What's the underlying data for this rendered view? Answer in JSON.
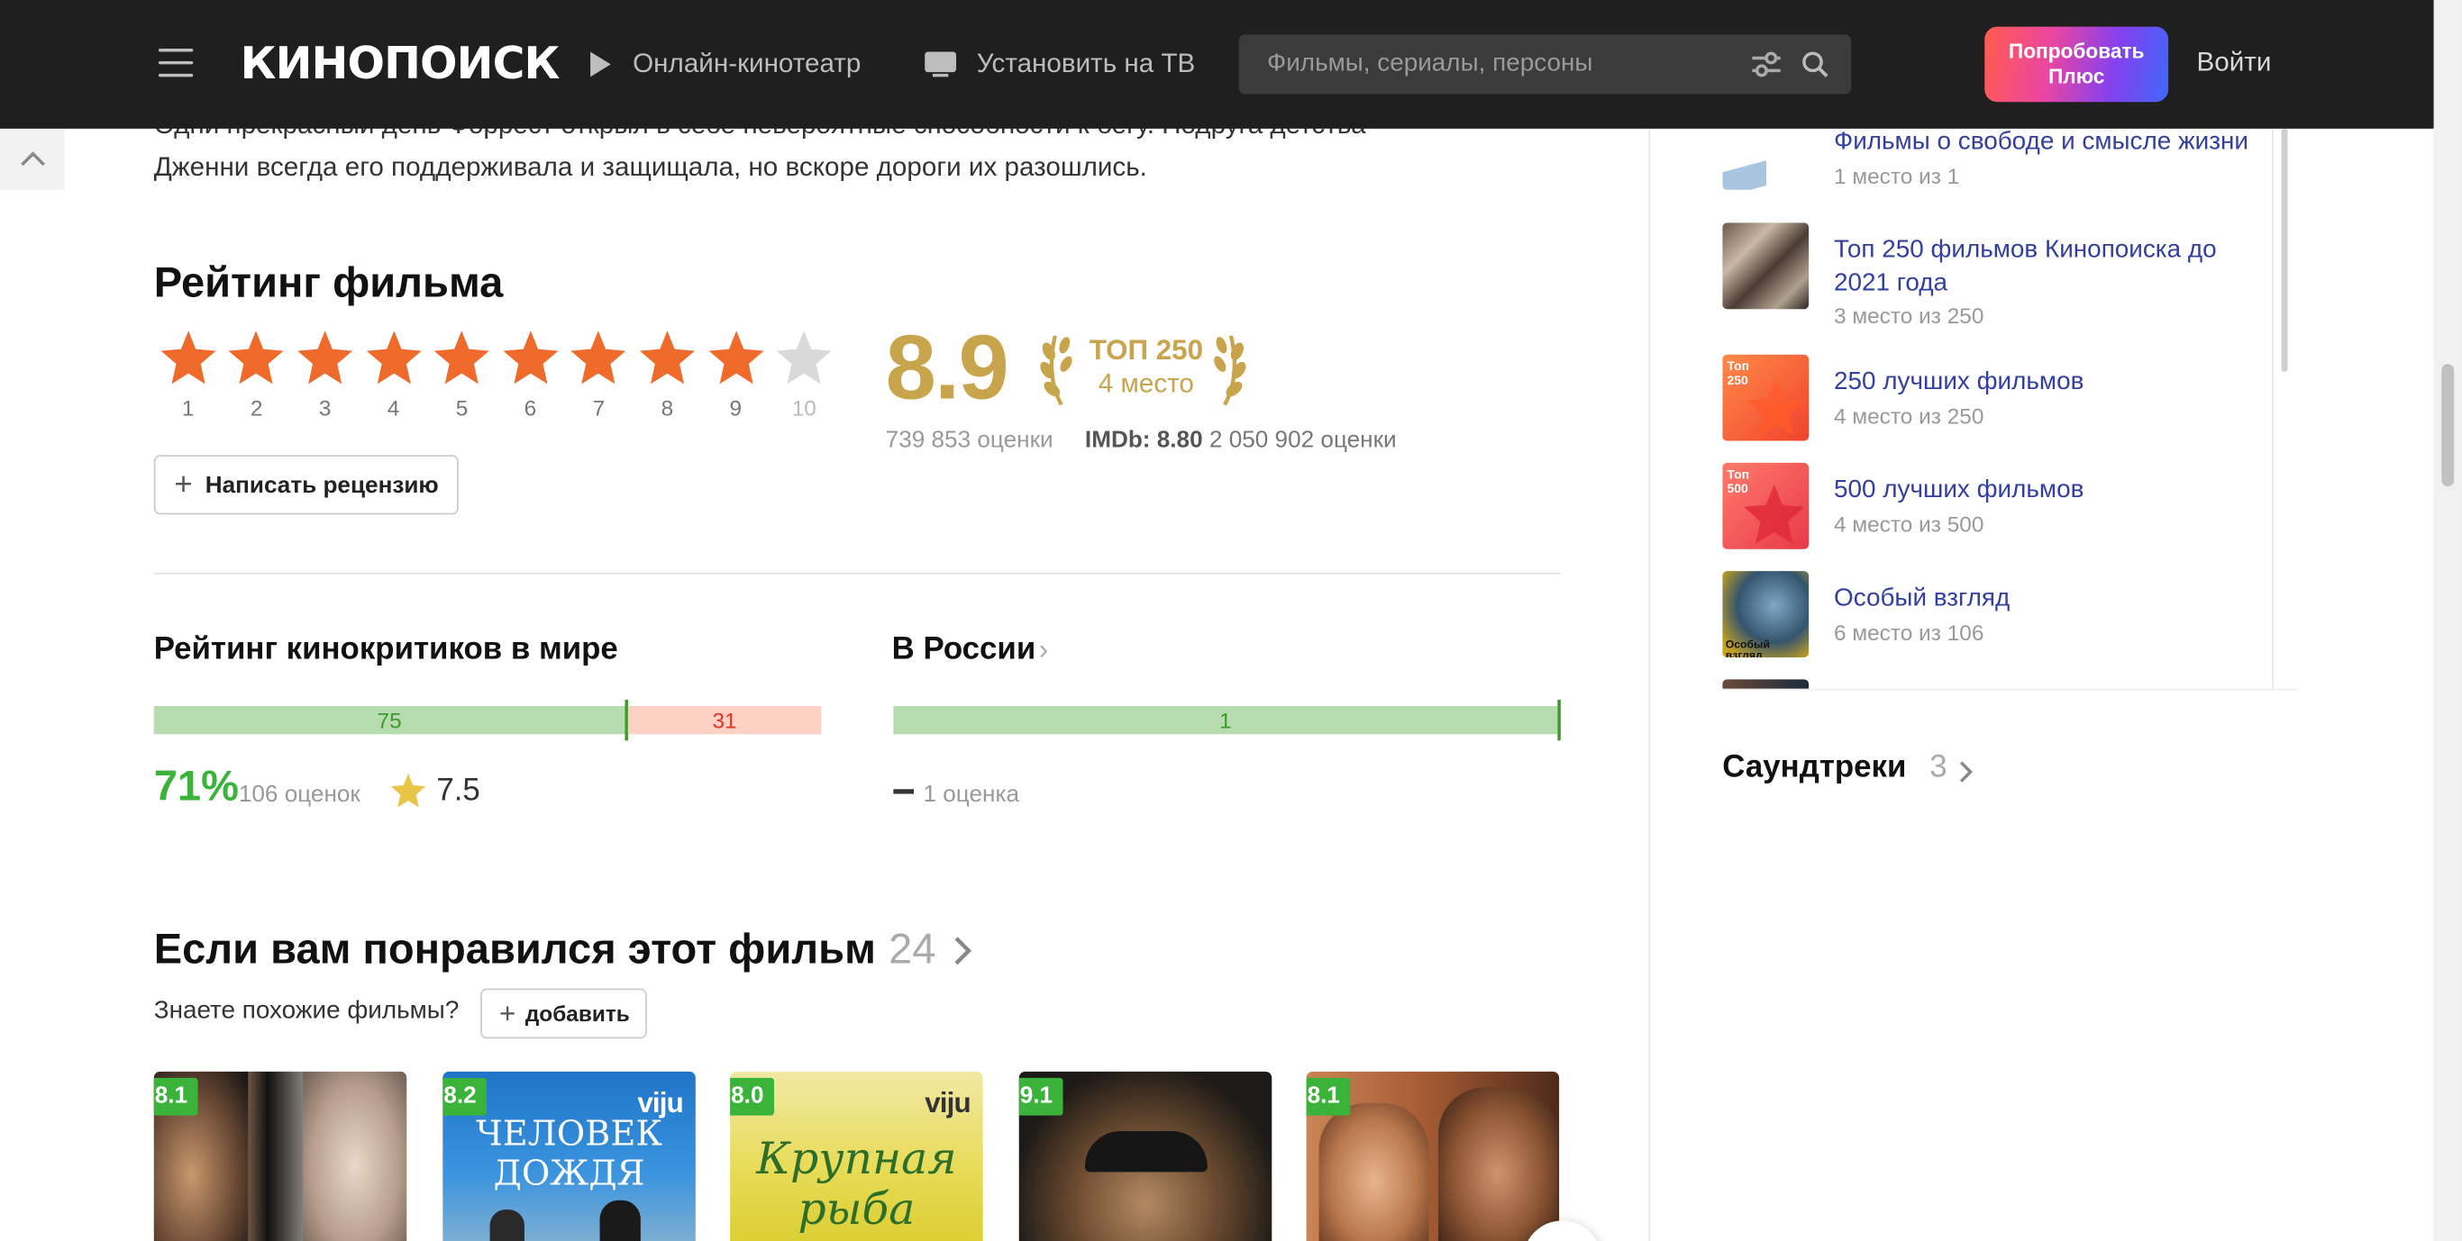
{
  "header": {
    "logo": "КИНОПОИСК",
    "nav_online": "Онлайн-кинотеатр",
    "nav_tv": "Установить на ТВ",
    "search_placeholder": "Фильмы, сериалы, персоны",
    "plus_button": "Попробовать Плюс",
    "login": "Войти"
  },
  "synopsis": {
    "line1": "Одни прекрасный день Форрест открыл в себе невероятные способности к бегу. Подруга детства",
    "line2": "Дженни всегда его поддерживала и защищала, но вскоре дороги их разошлись."
  },
  "rating": {
    "title": "Рейтинг фильма",
    "stars": [
      "1",
      "2",
      "3",
      "4",
      "5",
      "6",
      "7",
      "8",
      "9",
      "10"
    ],
    "selected_stars": 9,
    "score": "8.9",
    "top250_title": "ТОП 250",
    "top250_place": "4 место",
    "votes": "739 853 оценки",
    "imdb_label": "IMDb: 8.80",
    "imdb_votes": "2 050 902 оценки",
    "review_button": "Написать рецензию"
  },
  "critics": {
    "world_title": "Рейтинг кинокритиков в мире",
    "world_positive": "75",
    "world_negative": "31",
    "world_percent": "71%",
    "world_count": "106 оценок",
    "world_avg": "7.5",
    "russia_title": "В России",
    "russia_positive": "1",
    "russia_count": "1 оценка"
  },
  "similar": {
    "title": "Если вам понравился этот фильм",
    "count": "24",
    "question": "Знаете похожие фильмы?",
    "add_button": "добавить",
    "posters": [
      {
        "rating": "8.1",
        "text": ""
      },
      {
        "rating": "8.2",
        "text": "ЧЕЛОВЕК ДОЖДЯ",
        "badge": "viju"
      },
      {
        "rating": "8.0",
        "text": "Крупная рыба",
        "badge": "viju"
      },
      {
        "rating": "9.1",
        "text": ""
      },
      {
        "rating": "8.1",
        "text": ""
      }
    ]
  },
  "lists": [
    {
      "title": "Фильмы о свободе и смысле жизни",
      "sub": "1 место из 1"
    },
    {
      "title": "Топ 250 фильмов Кинопоиска до 2021 года",
      "sub": "3 место из 250"
    },
    {
      "title": "250 лучших фильмов",
      "sub": "4 место из 250",
      "thumb_text": "Топ 250"
    },
    {
      "title": "500 лучших фильмов",
      "sub": "4 место из 500",
      "thumb_text": "Топ 500"
    },
    {
      "title": "Особый взгляд",
      "sub": "6 место из 106",
      "thumb_text": "Особый взгляд"
    }
  ],
  "soundtracks": {
    "title": "Саундтреки",
    "count": "3"
  },
  "colors": {
    "header_bg": "#1f1f1f",
    "star_on": "#ee6b2b",
    "star_off": "#d9d9d9",
    "gold": "#c8a44d",
    "positive": "#3bb33b",
    "negative": "#e53222",
    "link": "#333fa0"
  }
}
